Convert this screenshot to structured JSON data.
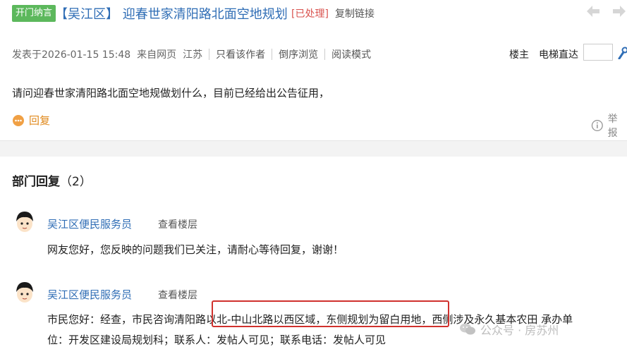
{
  "post": {
    "tag": "开门纳言",
    "title": "【吴江区】 迎春世家清阳路北面空地规划",
    "status": "[已处理]",
    "copy_link": "复制链接",
    "meta": {
      "published": "发表于2026-01-15 15:48",
      "source": "来自网页",
      "location": "江苏",
      "only_author": "只看该作者",
      "reverse": "倒序浏览",
      "read_mode": "阅读模式"
    },
    "owner_label": "楼主",
    "jump_label": "电梯直达",
    "jump_value": "",
    "question": "请问迎春世家清阳路北面空地规做划什么，目前已经给出公告征用，",
    "reply_label": "回复",
    "report_label": "举报"
  },
  "replies_section": {
    "title": "部门回复",
    "count": "（2）"
  },
  "replies": [
    {
      "author": "吴江区便民服务员",
      "floor_link": "查看楼层",
      "text": "网友您好，您反映的问题我们已关注，请耐心等待回复，谢谢！"
    },
    {
      "author": "吴江区便民服务员",
      "floor_link": "查看楼层",
      "text_line1": "市民您好：经查，市民咨询清阳路以北-中山北路以西区域，东侧规划为留白用地，西侧涉及永久基本农田 承办单",
      "text_line2": "位：开发区建设局规划科；联系人：发帖人可见；联系电话：发帖人可见"
    }
  ],
  "watermark": "公众号 · 房苏州",
  "colors": {
    "link_blue": "#2f6db5",
    "tag_green": "#5cb85c",
    "status_red": "#d9534f",
    "reply_orange": "#e08a1e",
    "highlight_red": "#d0312d"
  }
}
